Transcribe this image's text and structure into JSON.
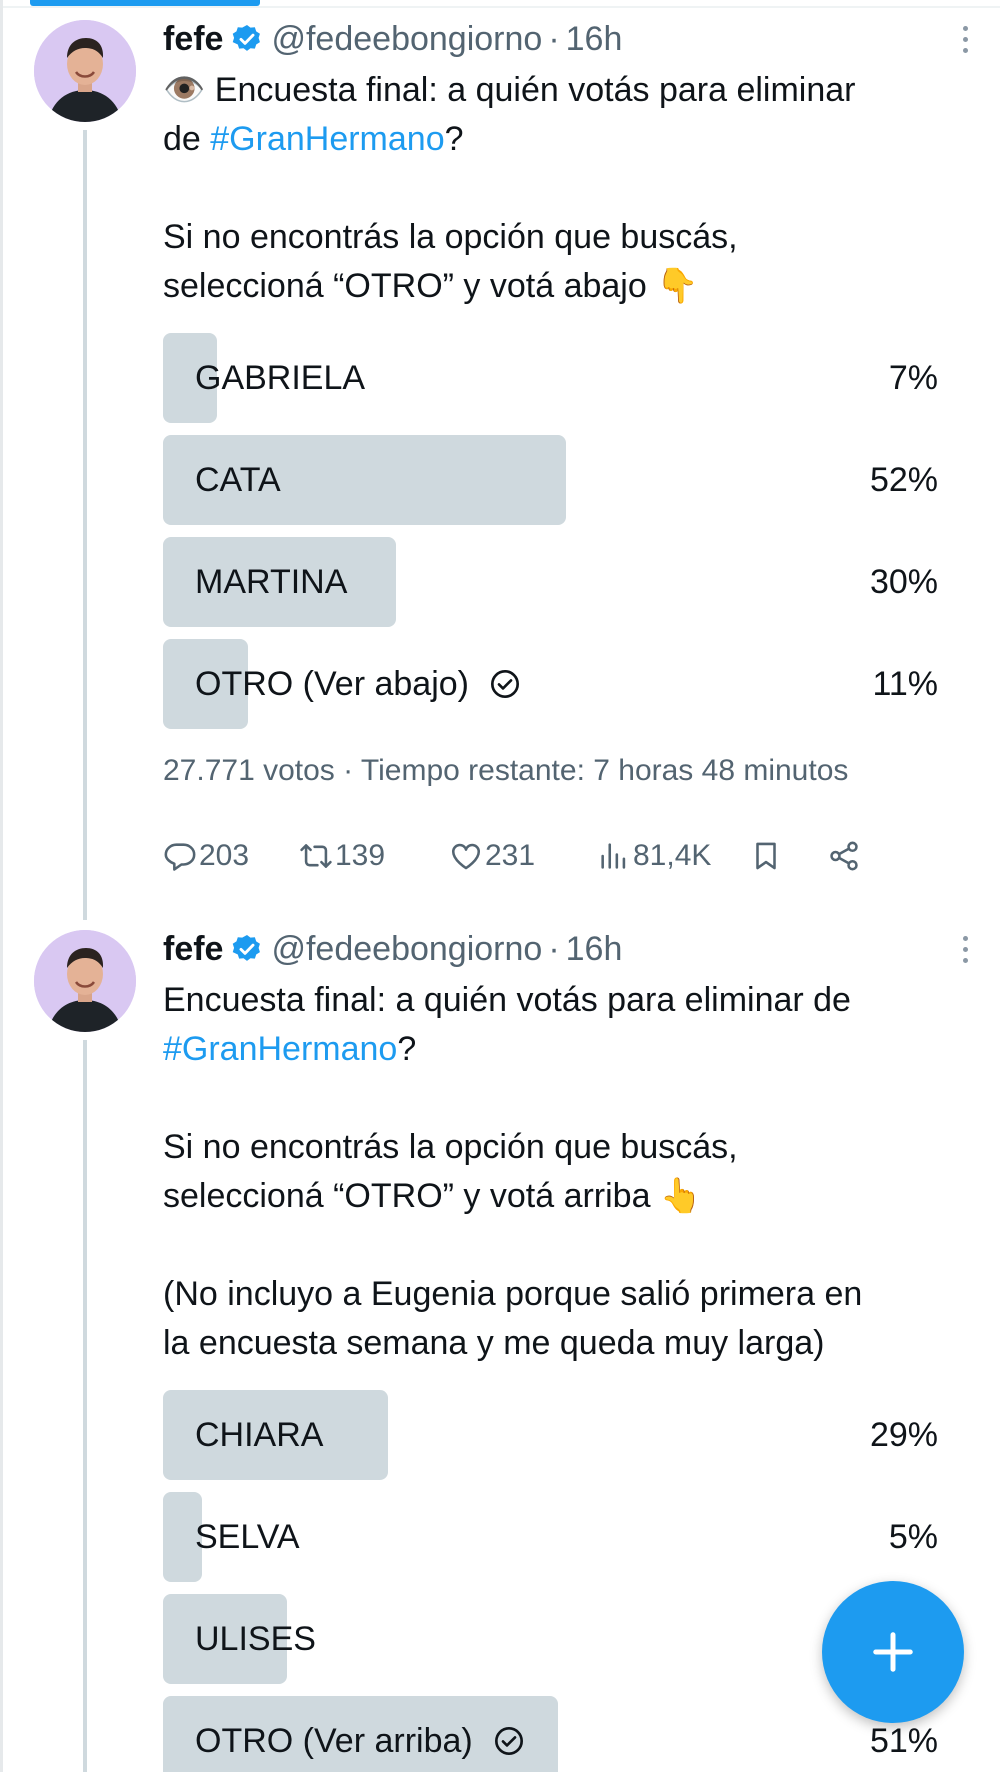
{
  "tweets": [
    {
      "author": {
        "name": "fefe",
        "handle": "@fedeebongiorno",
        "time": "16h"
      },
      "text": {
        "line1_prefix": "👁️ ",
        "line1": "Encuesta final: a quién votás para eliminar",
        "line2_prefix": "de ",
        "hashtag": "#GranHermano",
        "line2_suffix": "?",
        "line3": "Si no encontrás la opción que buscás,",
        "line4": "seleccioná “OTRO” y votá abajo 👇"
      },
      "poll": {
        "options": [
          {
            "label": "GABRIELA",
            "percent_text": "7%",
            "percent": 7,
            "selected": false
          },
          {
            "label": "CATA",
            "percent_text": "52%",
            "percent": 52,
            "selected": false
          },
          {
            "label": "MARTINA",
            "percent_text": "30%",
            "percent": 30,
            "selected": false
          },
          {
            "label": "OTRO (Ver abajo)",
            "percent_text": "11%",
            "percent": 11,
            "selected": true
          }
        ],
        "meta": "27.771 votos · Tiempo restante: 7 horas 48 minutos"
      },
      "actions": {
        "replies": "203",
        "retweets": "139",
        "likes": "231",
        "views": "81,4K"
      }
    },
    {
      "author": {
        "name": "fefe",
        "handle": "@fedeebongiorno",
        "time": "16h"
      },
      "text": {
        "line1": "Encuesta final: a quién votás para eliminar de",
        "hashtag": "#GranHermano",
        "line2_suffix": "?",
        "line3": "Si no encontrás la opción que buscás,",
        "line4": "seleccioná “OTRO” y votá arriba 👆",
        "line5": "(No incluyo a Eugenia porque salió primera en",
        "line6": "la encuesta semana y me queda muy larga)"
      },
      "poll": {
        "options": [
          {
            "label": "CHIARA",
            "percent_text": "29%",
            "percent": 29,
            "selected": false
          },
          {
            "label": "SELVA",
            "percent_text": "5%",
            "percent": 5,
            "selected": false
          },
          {
            "label": "ULISES",
            "percent_text": "",
            "percent": 16,
            "selected": false
          },
          {
            "label": "OTRO (Ver arriba)",
            "percent_text": "51%",
            "percent": 51,
            "selected": true
          }
        ]
      }
    }
  ],
  "colors": {
    "accent": "#1d9bf0",
    "bar": "#cfd9de",
    "muted": "#536471",
    "avatar_bg": "#d9c8f2"
  },
  "icons": [
    "verified-badge-icon",
    "more-options-icon",
    "reply-icon",
    "retweet-icon",
    "like-icon",
    "views-icon",
    "bookmark-icon",
    "share-icon",
    "check-circle-icon",
    "plus-icon"
  ]
}
